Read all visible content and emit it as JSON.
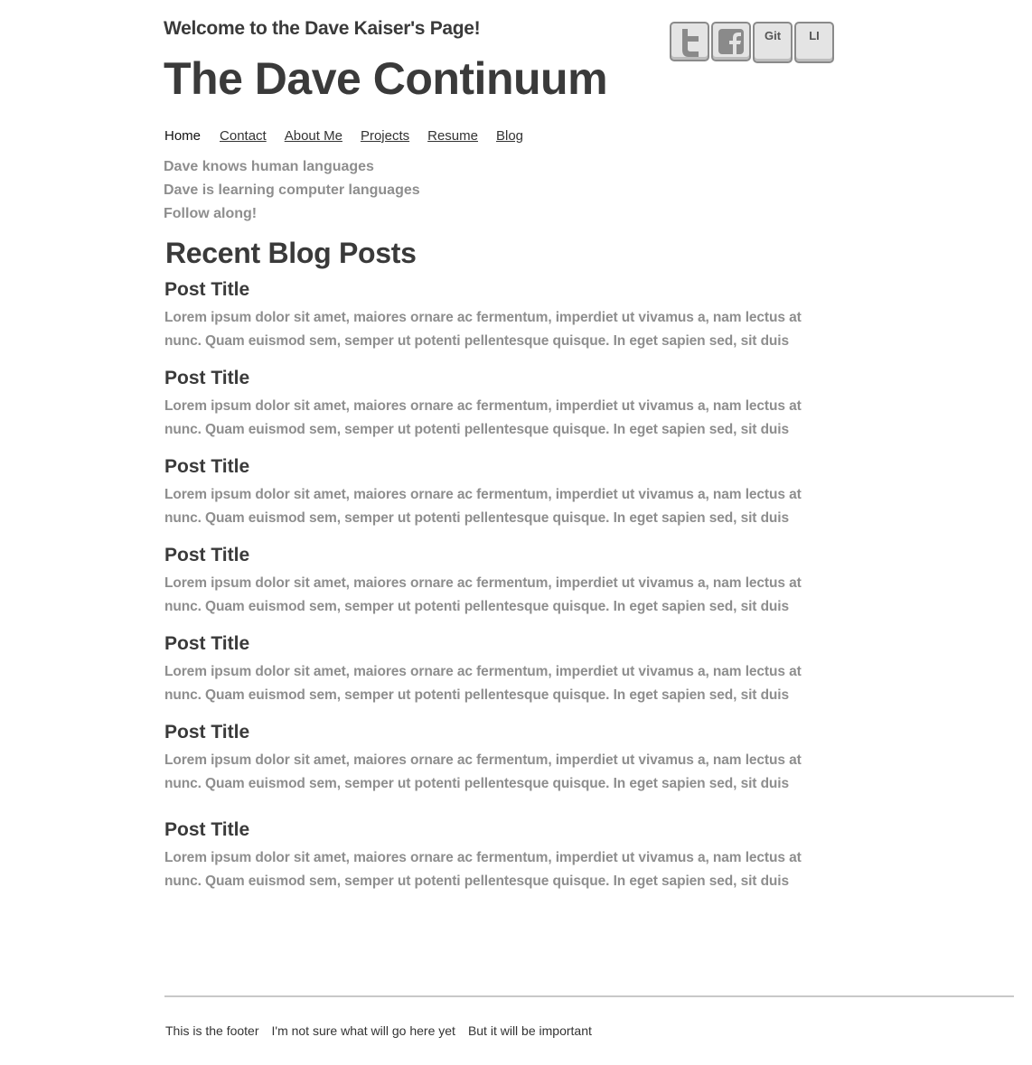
{
  "header": {
    "welcome": "Welcome to the Dave Kaiser's Page!",
    "title": "The Dave Continuum"
  },
  "social": {
    "twitter_icon": "twitter-icon",
    "facebook_icon": "facebook-icon",
    "git_label": "Git",
    "linkedin_label": "LI"
  },
  "nav": {
    "items": [
      {
        "label": "Home"
      },
      {
        "label": "Contact"
      },
      {
        "label": "About Me"
      },
      {
        "label": "Projects"
      },
      {
        "label": "Resume"
      },
      {
        "label": "Blog"
      }
    ]
  },
  "taglines": [
    "Dave knows human languages",
    "Dave is learning computer languages",
    "Follow along!"
  ],
  "blog": {
    "section_title": "Recent Blog Posts",
    "posts": [
      {
        "title": "Post Title",
        "body": "Lorem ipsum dolor sit amet, maiores ornare ac fermentum, imperdiet ut vivamus a, nam lectus at nunc. Quam euismod sem, semper ut potenti pellentesque quisque. In eget sapien sed, sit duis"
      },
      {
        "title": "Post Title",
        "body": "Lorem ipsum dolor sit amet, maiores ornare ac fermentum, imperdiet ut vivamus a, nam lectus at nunc. Quam euismod sem, semper ut potenti pellentesque quisque. In eget sapien sed, sit duis"
      },
      {
        "title": "Post Title",
        "body": "Lorem ipsum dolor sit amet, maiores ornare ac fermentum, imperdiet ut vivamus a, nam lectus at nunc. Quam euismod sem, semper ut potenti pellentesque quisque. In eget sapien sed, sit duis"
      },
      {
        "title": "Post Title",
        "body": "Lorem ipsum dolor sit amet, maiores ornare ac fermentum, imperdiet ut vivamus a, nam lectus at nunc. Quam euismod sem, semper ut potenti pellentesque quisque. In eget sapien sed, sit duis"
      },
      {
        "title": "Post Title",
        "body": "Lorem ipsum dolor sit amet, maiores ornare ac fermentum, imperdiet ut vivamus a, nam lectus at nunc. Quam euismod sem, semper ut potenti pellentesque quisque. In eget sapien sed, sit duis"
      },
      {
        "title": "Post Title",
        "body": "Lorem ipsum dolor sit amet, maiores ornare ac fermentum, imperdiet ut vivamus a, nam lectus at nunc. Quam euismod sem, semper ut potenti pellentesque quisque. In eget sapien sed, sit duis"
      },
      {
        "title": "Post Title",
        "body": "Lorem ipsum dolor sit amet, maiores ornare ac fermentum, imperdiet ut vivamus a, nam lectus at nunc. Quam euismod sem, semper ut potenti pellentesque quisque. In eget sapien sed, sit duis"
      }
    ]
  },
  "footer": {
    "items": [
      "This is the footer",
      "I'm not sure what will go here yet",
      "But it will be important"
    ]
  }
}
